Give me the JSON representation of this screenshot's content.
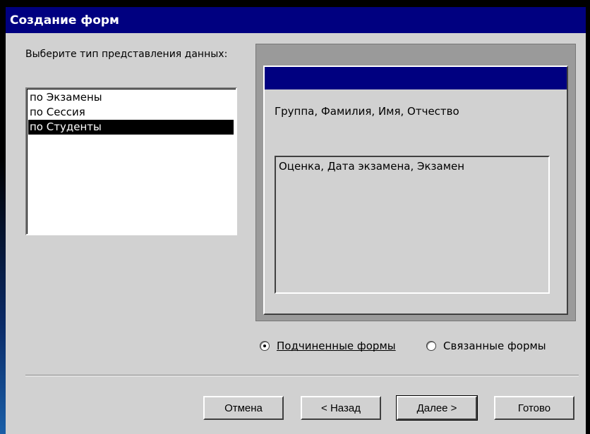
{
  "window": {
    "title": "Создание форм"
  },
  "prompt": "Выберите тип представления данных:",
  "list": {
    "items": [
      {
        "label": "по Экзамены",
        "selected": false
      },
      {
        "label": "по Сессия",
        "selected": false
      },
      {
        "label": "по Студенты",
        "selected": true
      }
    ]
  },
  "preview": {
    "main_fields": "Группа, Фамилия, Имя, Отчество",
    "subform_fields": "Оценка, Дата экзамена, Экзамен"
  },
  "options": {
    "subforms": {
      "label": "Подчиненные формы",
      "checked": true
    },
    "linked": {
      "label": "Связанные формы",
      "checked": false
    }
  },
  "buttons": {
    "cancel": "Отмена",
    "back": "< Назад",
    "next": "Далее >",
    "finish": "Готово"
  },
  "colors": {
    "titlebar": "#000080",
    "dialog_bg": "#d1d1d1",
    "selection": "#000000"
  }
}
